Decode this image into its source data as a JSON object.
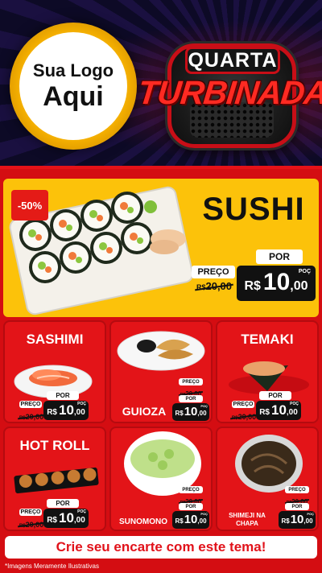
{
  "header": {
    "logo_line1": "Sua Logo",
    "logo_line2": "Aqui",
    "badge_top": "QUARTA",
    "badge_main": "TURBINADA"
  },
  "hero": {
    "discount": "-50%",
    "title": "SUSHI",
    "price_label_old": "PREÇO",
    "price_label_new": "POR",
    "old_currency": "R$",
    "old_price": "20,00",
    "currency": "R$",
    "price_int": "10",
    "price_dec": ",00",
    "poc": "POÇ"
  },
  "products": [
    {
      "title": "SASHIMI",
      "label_old": "PREÇO",
      "label_new": "POR",
      "old_currency": "R$",
      "old_price": "20,00",
      "currency": "R$",
      "price_int": "10",
      "price_dec": ",00",
      "poc": "POÇ"
    },
    {
      "title": "GUIOZA",
      "label_old": "PREÇO",
      "label_new": "POR",
      "old_currency": "R$",
      "old_price": "20,00",
      "currency": "R$",
      "price_int": "10",
      "price_dec": ",00",
      "poc": "POÇ"
    },
    {
      "title": "TEMAKI",
      "label_old": "PREÇO",
      "label_new": "POR",
      "old_currency": "R$",
      "old_price": "20,00",
      "currency": "R$",
      "price_int": "10",
      "price_dec": ",00",
      "poc": "POÇ"
    },
    {
      "title": "HOT ROLL",
      "label_old": "PREÇO",
      "label_new": "POR",
      "old_currency": "R$",
      "old_price": "20,00",
      "currency": "R$",
      "price_int": "10",
      "price_dec": ",00",
      "poc": "POÇ"
    },
    {
      "title": "SUNOMONO",
      "label_old": "PREÇO",
      "label_new": "POR",
      "old_currency": "R$",
      "old_price": "20,00",
      "currency": "R$",
      "price_int": "10",
      "price_dec": ",00",
      "poc": "POÇ"
    },
    {
      "title_line1": "SHIMEJI NA",
      "title_line2": "CHAPA",
      "label_old": "PREÇO",
      "label_new": "POR",
      "old_currency": "R$",
      "old_price": "20,00",
      "currency": "R$",
      "price_int": "10",
      "price_dec": ",00",
      "poc": "POÇ"
    }
  ],
  "footer": {
    "cta": "Crie seu encarte com este tema!",
    "disclaimer": "*Imagens Meramente Ilustrativas"
  },
  "colors": {
    "brand_red": "#e31418",
    "hero_yellow": "#fcc20a",
    "header_navy": "#120c33",
    "price_black": "#111111"
  },
  "icons": [
    "sushi-platter-image",
    "sashimi-image",
    "guioza-image",
    "temaki-image",
    "hot-roll-image",
    "sunomono-image",
    "shimeji-image"
  ]
}
